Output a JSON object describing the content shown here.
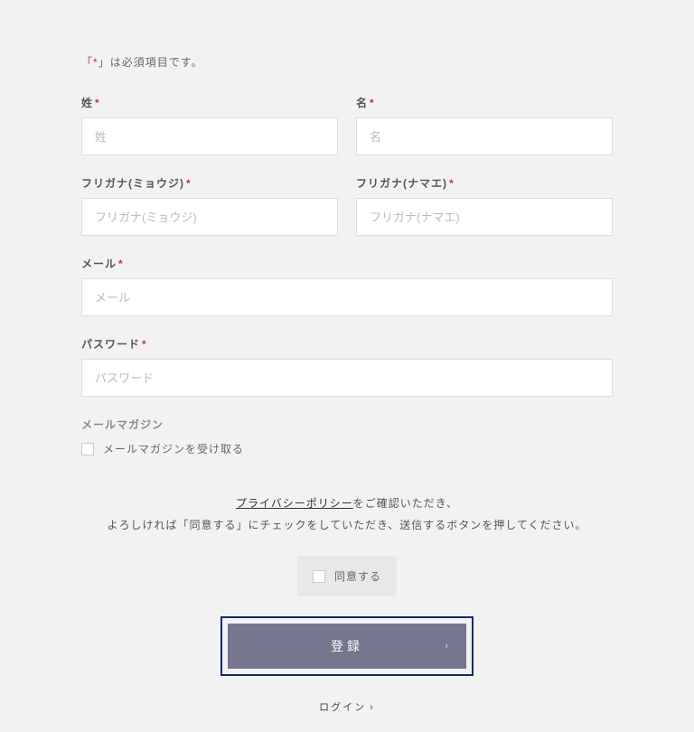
{
  "notice": {
    "pre": "「",
    "ast": "*",
    "post": "」は必須項目です。"
  },
  "fields": {
    "sei_label": "姓",
    "sei_ph": "姓",
    "mei_label": "名",
    "mei_ph": "名",
    "furi_sei_label": "フリガナ(ミョウジ)",
    "furi_sei_ph": "フリガナ(ミョウジ)",
    "furi_mei_label": "フリガナ(ナマエ)",
    "furi_mei_ph": "フリガナ(ナマエ)",
    "mail_label": "メール",
    "mail_ph": "メール",
    "pass_label": "パスワード",
    "pass_ph": "パスワード"
  },
  "magazine": {
    "title": "メールマガジン",
    "opt": "メールマガジンを受け取る"
  },
  "policy": {
    "link": "プライバシーポリシー",
    "after_link": "をご確認いただき、",
    "line2": "よろしければ「同意する」にチェックをしていただき、送信するボタンを押してください。"
  },
  "agree": {
    "label": "同意する"
  },
  "submit": {
    "label": "登録"
  },
  "login": {
    "label": "ログイン"
  }
}
